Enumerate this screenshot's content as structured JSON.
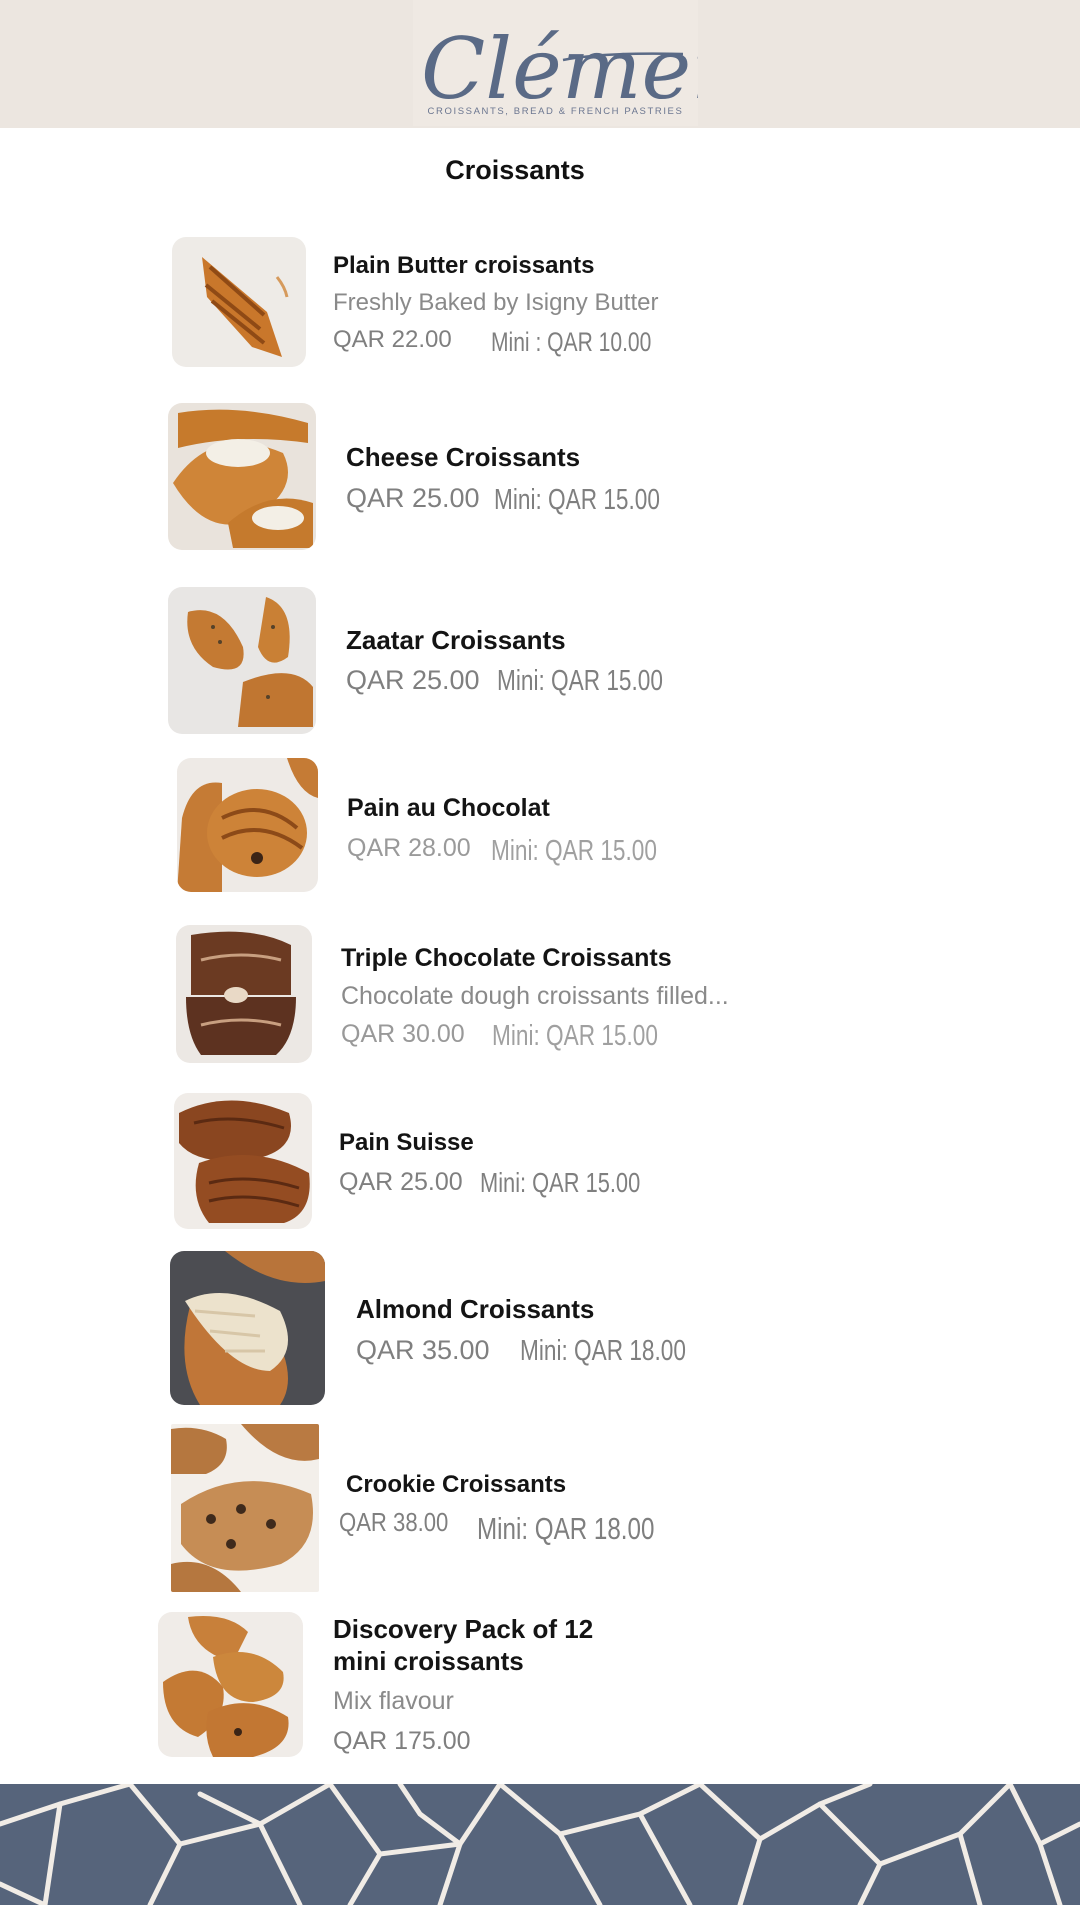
{
  "brand": {
    "logo_text": "Clément",
    "tagline": "CROISSANTS, BREAD & FRENCH PASTRIES"
  },
  "section": {
    "title": "Croissants"
  },
  "colors": {
    "header_bg": "#ece6e0",
    "logo_ink": "#5a6a86",
    "footer_bg": "#56647b",
    "footer_lines": "#f1ece6"
  },
  "items": [
    {
      "name": "Plain Butter croissants",
      "desc": "Freshly Baked by Isigny Butter",
      "price": "QAR 22.00",
      "mini": "Mini : QAR 10.00"
    },
    {
      "name": "Cheese Croissants",
      "price": "QAR 25.00",
      "mini": "Mini: QAR 15.00"
    },
    {
      "name": "Zaatar Croissants",
      "price": "QAR 25.00",
      "mini": "Mini: QAR 15.00"
    },
    {
      "name": "Pain au Chocolat",
      "price": "QAR 28.00",
      "mini": "Mini: QAR 15.00"
    },
    {
      "name": "Triple Chocolate Croissants",
      "desc": "Chocolate dough croissants filled...",
      "price": "QAR 30.00",
      "mini": "Mini: QAR 15.00"
    },
    {
      "name": "Pain Suisse",
      "price": "QAR 25.00",
      "mini": "Mini: QAR 15.00"
    },
    {
      "name": "Almond Croissants",
      "price": "QAR 35.00",
      "mini": "Mini: QAR 18.00"
    },
    {
      "name": "Crookie Croissants",
      "price": "QAR 38.00",
      "mini": "Mini: QAR 18.00"
    },
    {
      "name_line1": "Discovery Pack of 12",
      "name_line2": "mini croissants",
      "desc": "Mix flavour",
      "price": "QAR 175.00"
    }
  ]
}
